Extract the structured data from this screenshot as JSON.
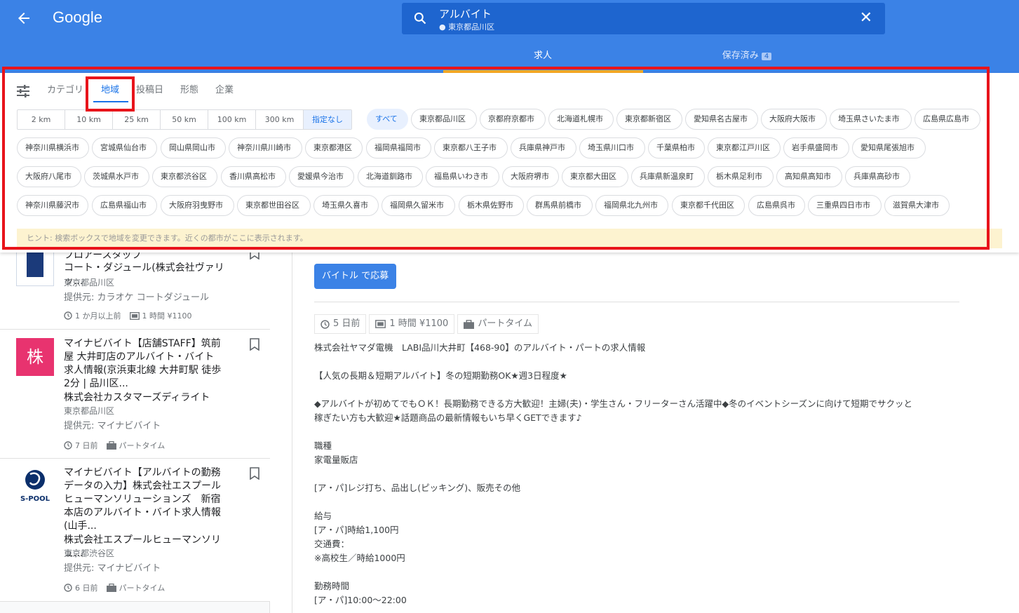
{
  "header": {
    "logo": "Google",
    "search_query": "アルバイト",
    "search_location": "東京都品川区",
    "tabs": [
      {
        "label": "求人"
      },
      {
        "label": "保存済み",
        "badge": "4"
      }
    ]
  },
  "filters": {
    "tabs": [
      "カテゴリ",
      "地域",
      "投稿日",
      "形態",
      "企業"
    ],
    "distances": [
      "2 km",
      "10 km",
      "25 km",
      "50 km",
      "100 km",
      "300 km",
      "指定なし"
    ],
    "row1": [
      "すべて",
      "東京都品川区",
      "京都府京都市",
      "北海道札幌市",
      "東京都新宿区",
      "愛知県名古屋市",
      "大阪府大阪市",
      "埼玉県さいたま市",
      "広島県広島市"
    ],
    "row2": [
      "神奈川県横浜市",
      "宮城県仙台市",
      "岡山県岡山市",
      "神奈川県川崎市",
      "東京都港区",
      "福岡県福岡市",
      "東京都八王子市",
      "兵庫県神戸市",
      "埼玉県川口市",
      "千葉県柏市",
      "東京都江戸川区",
      "岩手県盛岡市",
      "愛知県尾張旭市"
    ],
    "row3": [
      "大阪府八尾市",
      "茨城県水戸市",
      "東京都渋谷区",
      "香川県高松市",
      "愛媛県今治市",
      "北海道釧路市",
      "福島県いわき市",
      "大阪府堺市",
      "東京都大田区",
      "兵庫県新温泉町",
      "栃木県足利市",
      "高知県高知市",
      "兵庫県高砂市"
    ],
    "row4": [
      "神奈川県藤沢市",
      "広島県福山市",
      "大阪府羽曳野市",
      "東京都世田谷区",
      "埼玉県久喜市",
      "福岡県久留米市",
      "栃木県佐野市",
      "群馬県前橋市",
      "福岡県北九州市",
      "東京都千代田区",
      "広島県呉市",
      "三重県四日市市",
      "滋賀県大津市"
    ],
    "hint": "ヒント: 検索ボックスで地域を変更できます。近くの都市がここに表示されます。"
  },
  "jobs": [
    {
      "title": "コート・ダジュール(株式会社ヴァリッ...",
      "partial_title": "フロアースタッフ",
      "location": "東京都品川区",
      "source": "提供元: カラオケ コートダジュール",
      "posted": "1 か月以上前",
      "pay": "1 時間 ¥1100"
    },
    {
      "title_lines": [
        "マイナビバイト【店舗STAFF】筑前",
        "屋 大井町店のアルバイト・バイト",
        "求人情報(京浜東北線 大井町駅 徒歩",
        "2分 | 品川区..."
      ],
      "thumb_text": "株",
      "company": "株式会社カスタマーズディライト",
      "location": "東京都品川区",
      "source": "提供元: マイナビバイト",
      "posted": "7 日前",
      "type": "パートタイム"
    },
    {
      "title_lines": [
        "マイナビバイト【アルバイトの勤務",
        "データの入力】株式会社エスプール",
        "ヒューマンソリューションズ　新宿",
        "本店のアルバイト・バイト求人情報",
        "(山手..."
      ],
      "thumb_text": "S-POOL",
      "company": "株式会社エスプールヒューマンソリュ...",
      "location": "東京都渋谷区",
      "source": "提供元: マイナビバイト",
      "posted": "6 日前",
      "type": "パートタイム"
    }
  ],
  "detail": {
    "apply_label": "バイトル で応募",
    "posted": "5 日前",
    "pay": "1 時間 ¥1100",
    "type": "パートタイム",
    "paragraphs": [
      "株式会社ヤマダ電機　LABI品川大井町【468-90】のアルバイト・パートの求人情報",
      "【人気の長期＆短期アルバイト】冬の短期勤務OK★週3日程度★",
      "◆アルバイトが初めてでもＯＫ！長期勤務できる方大歓迎！主婦(夫)・学生さん・フリーターさん活躍中◆冬のイベントシーズンに向けて短期でサクッと\n稼ぎたい方も大歓迎★話題商品の最新情報もいち早くGETできます♪",
      "職種\n家電量販店",
      "[ア・パ]レジ打ち、品出し(ピッキング)、販売その他",
      "給与\n[ア・パ]時給1,100円\n交通費：\n※高校生／時給1000円",
      "勤務時間\n[ア・パ]10:00～22:00"
    ]
  },
  "colors": {
    "header_blue": "#3b82e6",
    "accent_orange": "#f3a825",
    "highlight_red": "#e8141b"
  }
}
